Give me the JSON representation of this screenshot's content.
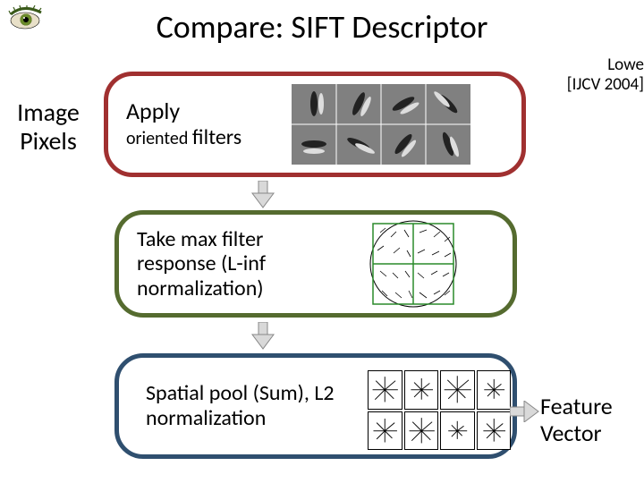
{
  "title": "Compare: SIFT Descriptor",
  "citation_line1": "Lowe",
  "citation_line2": "[IJCV 2004]",
  "input_label_l1": "Image",
  "input_label_l2": "Pixels",
  "output_label_l1": "Feature",
  "output_label_l2": "Vector",
  "stage1": {
    "line1": "Apply",
    "line2_small": "oriented",
    "line2_big": "filters"
  },
  "stage2": {
    "text": "Take max filter response (L-inf normalization)"
  },
  "stage3": {
    "text": "Spatial pool (Sum), L2 normalization"
  },
  "icons": {
    "logo": "eye-logo",
    "arrow_down": "arrow-down-icon",
    "arrow_right": "arrow-right-icon"
  }
}
